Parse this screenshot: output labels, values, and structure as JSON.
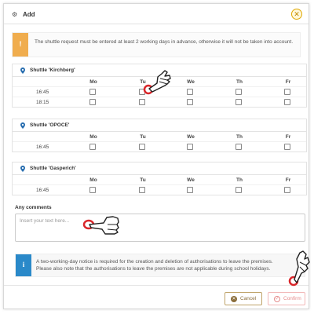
{
  "dialog": {
    "title": "Add",
    "title_icon": "gears-icon",
    "close_symbol": "✕"
  },
  "warning": {
    "icon": "!",
    "text": "The shuttle request must be entered at least 2 working days in advance, otherwise it will not be taken into account."
  },
  "days": [
    "Mo",
    "Tu",
    "We",
    "Th",
    "Fr"
  ],
  "shuttles": [
    {
      "name": "Shuttle 'Kirchberg'",
      "rows": [
        {
          "time": "16:45",
          "checked": [
            false,
            false,
            false,
            false,
            false
          ]
        },
        {
          "time": "18:15",
          "checked": [
            false,
            false,
            false,
            false,
            false
          ]
        }
      ]
    },
    {
      "name": "Shuttle 'OPOCE'",
      "rows": [
        {
          "time": "16:45",
          "checked": [
            false,
            false,
            false,
            false,
            false
          ]
        }
      ]
    },
    {
      "name": "Shuttle 'Gasperich'",
      "rows": [
        {
          "time": "16:45",
          "checked": [
            false,
            false,
            false,
            false,
            false
          ]
        }
      ]
    }
  ],
  "comments": {
    "label": "Any comments",
    "placeholder": "Insert your text here..."
  },
  "info": {
    "icon": "i",
    "line1": "A two-working-day notice is required for the creation and deletion of authorisations to leave the premises.",
    "line2": "Please also note that the authorisations to leave the premises are not applicable during school holidays."
  },
  "buttons": {
    "cancel": "Cancel",
    "confirm": "Confirm"
  },
  "colors": {
    "warning": "#f0ad4e",
    "info": "#2a89c9",
    "cancel": "#8a6d3b",
    "confirm": "#e58a8a",
    "pointer_ring": "#d9262a"
  }
}
